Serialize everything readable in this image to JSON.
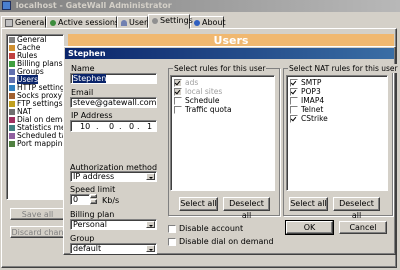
{
  "window": {
    "title": "localhost - GateWall Administrator",
    "tabs": [
      {
        "label": "General",
        "icon": "general-icon"
      },
      {
        "label": "Active sessions",
        "icon": "sessions-icon"
      },
      {
        "label": "Users",
        "icon": "users-icon"
      },
      {
        "label": "Settings",
        "icon": "settings-icon"
      },
      {
        "label": "About",
        "icon": "about-icon"
      }
    ],
    "active_tab": "Settings",
    "panel_heading": "Users",
    "tree": [
      {
        "label": "General",
        "icon": "general-icon"
      },
      {
        "label": "Cache",
        "icon": "cache-icon"
      },
      {
        "label": "Rules",
        "icon": "rules-icon"
      },
      {
        "label": "Billing plans",
        "icon": "billing-icon"
      },
      {
        "label": "Groups",
        "icon": "groups-icon"
      },
      {
        "label": "Users",
        "icon": "users-icon",
        "selected": true
      },
      {
        "label": "HTTP setting",
        "icon": "http-icon"
      },
      {
        "label": "Socks proxy",
        "icon": "socks-icon"
      },
      {
        "label": "FTP settings",
        "icon": "ftp-icon"
      },
      {
        "label": "NAT",
        "icon": "nat-icon"
      },
      {
        "label": "Dial on deman",
        "icon": "dial-icon"
      },
      {
        "label": "Statistics me",
        "icon": "statistics-icon"
      },
      {
        "label": "Scheduled ta",
        "icon": "scheduled-icon"
      },
      {
        "label": "Port mapping",
        "icon": "port-mapping-icon"
      }
    ],
    "bottom_buttons": [
      "Save all",
      "Discard chan"
    ]
  },
  "dialog": {
    "title": "Stephen",
    "name_label": "Name",
    "name_value": "Stephen",
    "email_label": "Email",
    "email_value": "steve@gatewall.com",
    "ip_label": "IP Address",
    "ip_octets": [
      "10",
      "0",
      "0",
      "1"
    ],
    "auth_label": "Authorization method",
    "auth_value": "IP address",
    "speed_label": "Speed limit",
    "speed_value": "0",
    "speed_unit": "Kb/s",
    "billing_label": "Billing plan",
    "billing_value": "Personal",
    "group_label": "Group",
    "group_value": "default",
    "rules_title": "Select rules for this user",
    "rules": [
      {
        "label": "ads",
        "checked": true,
        "disabled": true
      },
      {
        "label": "local sites",
        "checked": true,
        "disabled": true
      },
      {
        "label": "Schedule",
        "checked": false,
        "disabled": false
      },
      {
        "label": "Traffic quota",
        "checked": false,
        "disabled": false
      }
    ],
    "nat_title": "Select NAT rules for this user",
    "nat_rules": [
      {
        "label": "SMTP",
        "checked": true
      },
      {
        "label": "POP3",
        "checked": true
      },
      {
        "label": "IMAP4",
        "checked": false
      },
      {
        "label": "Telnet",
        "checked": false
      },
      {
        "label": "CStrike",
        "checked": true
      }
    ],
    "select_all": "Select all",
    "deselect_all": "Deselect all",
    "disable_account": "Disable account",
    "disable_dial": "Disable dial on demand",
    "ok": "OK",
    "cancel": "Cancel"
  },
  "colors": {
    "face": "#d4d0c8",
    "title_active": "#0a246a",
    "title_inactive": "#808080",
    "heading_bg": "#f0b870"
  }
}
